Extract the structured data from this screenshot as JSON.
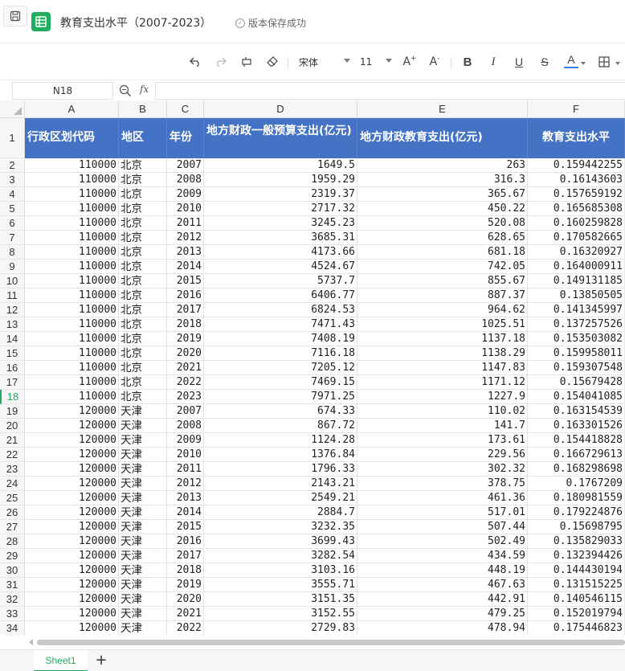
{
  "title_bar": {
    "doc_title": "教育支出水平（2007-2023）",
    "save_status": "版本保存成功"
  },
  "toolbar": {
    "font_name": "宋体",
    "font_size": "11",
    "bold": "B",
    "italic": "I",
    "underline": "U",
    "strike": "S",
    "font_color": "A",
    "increase_font": "A",
    "decrease_font": "A"
  },
  "formula_bar": {
    "cell_ref": "N18",
    "fx_label": "fx",
    "formula": ""
  },
  "columns": [
    "A",
    "B",
    "C",
    "D",
    "E",
    "F"
  ],
  "header_row_number": "1",
  "headers": [
    "行政区划代码",
    "地区",
    "年份",
    "地方财政一般预算支出(亿元)",
    "地方财政教育支出(亿元)",
    "教育支出水平"
  ],
  "active_row": 18,
  "rows": [
    {
      "n": "2",
      "code": "110000",
      "region": "北京",
      "year": "2007",
      "budget": "1649.5",
      "edu": "263",
      "level": "0.159442255"
    },
    {
      "n": "3",
      "code": "110000",
      "region": "北京",
      "year": "2008",
      "budget": "1959.29",
      "edu": "316.3",
      "level": "0.16143603"
    },
    {
      "n": "4",
      "code": "110000",
      "region": "北京",
      "year": "2009",
      "budget": "2319.37",
      "edu": "365.67",
      "level": "0.157659192"
    },
    {
      "n": "5",
      "code": "110000",
      "region": "北京",
      "year": "2010",
      "budget": "2717.32",
      "edu": "450.22",
      "level": "0.165685308"
    },
    {
      "n": "6",
      "code": "110000",
      "region": "北京",
      "year": "2011",
      "budget": "3245.23",
      "edu": "520.08",
      "level": "0.160259828"
    },
    {
      "n": "7",
      "code": "110000",
      "region": "北京",
      "year": "2012",
      "budget": "3685.31",
      "edu": "628.65",
      "level": "0.170582665"
    },
    {
      "n": "8",
      "code": "110000",
      "region": "北京",
      "year": "2013",
      "budget": "4173.66",
      "edu": "681.18",
      "level": "0.16320927"
    },
    {
      "n": "9",
      "code": "110000",
      "region": "北京",
      "year": "2014",
      "budget": "4524.67",
      "edu": "742.05",
      "level": "0.164000911"
    },
    {
      "n": "10",
      "code": "110000",
      "region": "北京",
      "year": "2015",
      "budget": "5737.7",
      "edu": "855.67",
      "level": "0.149131185"
    },
    {
      "n": "11",
      "code": "110000",
      "region": "北京",
      "year": "2016",
      "budget": "6406.77",
      "edu": "887.37",
      "level": "0.13850505"
    },
    {
      "n": "12",
      "code": "110000",
      "region": "北京",
      "year": "2017",
      "budget": "6824.53",
      "edu": "964.62",
      "level": "0.141345997"
    },
    {
      "n": "13",
      "code": "110000",
      "region": "北京",
      "year": "2018",
      "budget": "7471.43",
      "edu": "1025.51",
      "level": "0.137257526"
    },
    {
      "n": "14",
      "code": "110000",
      "region": "北京",
      "year": "2019",
      "budget": "7408.19",
      "edu": "1137.18",
      "level": "0.153503082"
    },
    {
      "n": "15",
      "code": "110000",
      "region": "北京",
      "year": "2020",
      "budget": "7116.18",
      "edu": "1138.29",
      "level": "0.159958011"
    },
    {
      "n": "16",
      "code": "110000",
      "region": "北京",
      "year": "2021",
      "budget": "7205.12",
      "edu": "1147.83",
      "level": "0.159307548"
    },
    {
      "n": "17",
      "code": "110000",
      "region": "北京",
      "year": "2022",
      "budget": "7469.15",
      "edu": "1171.12",
      "level": "0.15679428"
    },
    {
      "n": "18",
      "code": "110000",
      "region": "北京",
      "year": "2023",
      "budget": "7971.25",
      "edu": "1227.9",
      "level": "0.154041085"
    },
    {
      "n": "19",
      "code": "120000",
      "region": "天津",
      "year": "2007",
      "budget": "674.33",
      "edu": "110.02",
      "level": "0.163154539"
    },
    {
      "n": "20",
      "code": "120000",
      "region": "天津",
      "year": "2008",
      "budget": "867.72",
      "edu": "141.7",
      "level": "0.163301526"
    },
    {
      "n": "21",
      "code": "120000",
      "region": "天津",
      "year": "2009",
      "budget": "1124.28",
      "edu": "173.61",
      "level": "0.154418828"
    },
    {
      "n": "22",
      "code": "120000",
      "region": "天津",
      "year": "2010",
      "budget": "1376.84",
      "edu": "229.56",
      "level": "0.166729613"
    },
    {
      "n": "23",
      "code": "120000",
      "region": "天津",
      "year": "2011",
      "budget": "1796.33",
      "edu": "302.32",
      "level": "0.168298698"
    },
    {
      "n": "24",
      "code": "120000",
      "region": "天津",
      "year": "2012",
      "budget": "2143.21",
      "edu": "378.75",
      "level": "0.1767209"
    },
    {
      "n": "25",
      "code": "120000",
      "region": "天津",
      "year": "2013",
      "budget": "2549.21",
      "edu": "461.36",
      "level": "0.180981559"
    },
    {
      "n": "26",
      "code": "120000",
      "region": "天津",
      "year": "2014",
      "budget": "2884.7",
      "edu": "517.01",
      "level": "0.179224876"
    },
    {
      "n": "27",
      "code": "120000",
      "region": "天津",
      "year": "2015",
      "budget": "3232.35",
      "edu": "507.44",
      "level": "0.15698795"
    },
    {
      "n": "28",
      "code": "120000",
      "region": "天津",
      "year": "2016",
      "budget": "3699.43",
      "edu": "502.49",
      "level": "0.135829033"
    },
    {
      "n": "29",
      "code": "120000",
      "region": "天津",
      "year": "2017",
      "budget": "3282.54",
      "edu": "434.59",
      "level": "0.132394426"
    },
    {
      "n": "30",
      "code": "120000",
      "region": "天津",
      "year": "2018",
      "budget": "3103.16",
      "edu": "448.19",
      "level": "0.144430194"
    },
    {
      "n": "31",
      "code": "120000",
      "region": "天津",
      "year": "2019",
      "budget": "3555.71",
      "edu": "467.63",
      "level": "0.131515225"
    },
    {
      "n": "32",
      "code": "120000",
      "region": "天津",
      "year": "2020",
      "budget": "3151.35",
      "edu": "442.91",
      "level": "0.140546115"
    },
    {
      "n": "33",
      "code": "120000",
      "region": "天津",
      "year": "2021",
      "budget": "3152.55",
      "edu": "479.25",
      "level": "0.152019794"
    },
    {
      "n": "34",
      "code": "120000",
      "region": "天津",
      "year": "2022",
      "budget": "2729.83",
      "edu": "478.94",
      "level": "0.175446823"
    }
  ],
  "sheet_tabs": [
    {
      "label": "Sheet1"
    }
  ],
  "add_sheet_label": "+",
  "colors": {
    "brand": "#1fae5e",
    "header_fill": "#4472c4",
    "header_text": "#ffffff"
  },
  "icons": [
    "save-icon",
    "sheet-app-icon",
    "check-circle-icon",
    "undo-icon",
    "redo-icon",
    "format-painter-icon",
    "eraser-icon",
    "zoom-icon",
    "borders-icon"
  ]
}
